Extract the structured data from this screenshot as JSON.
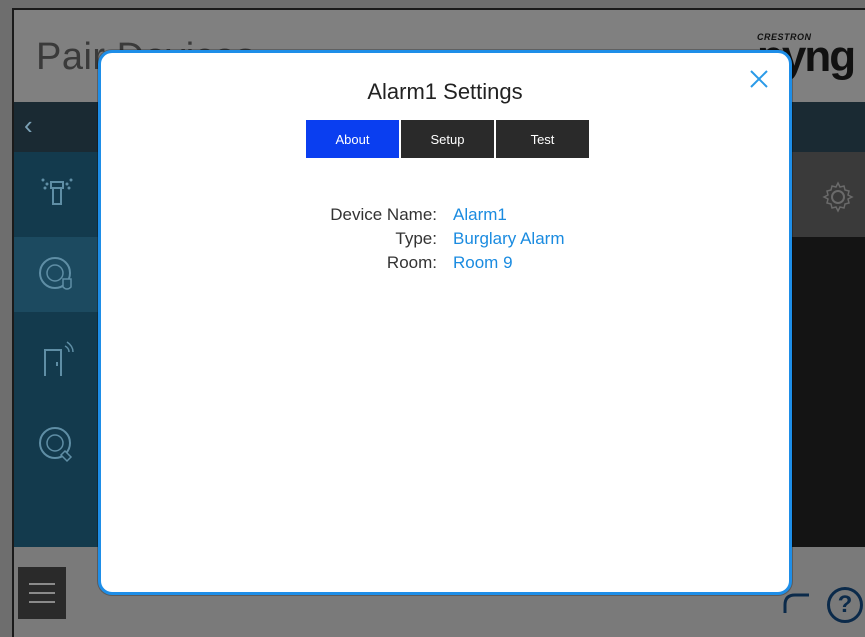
{
  "background": {
    "page_title": "Pair Devices",
    "logo": {
      "small": "CRESTRON",
      "big": "pyng"
    },
    "sidebar": {
      "items": [
        {
          "icon": "sprinkler-icon"
        },
        {
          "icon": "alarm-panel-icon",
          "active": true
        },
        {
          "icon": "door-sensor-icon"
        },
        {
          "icon": "keypad-icon"
        }
      ]
    },
    "help_label": "?"
  },
  "modal": {
    "title": "Alarm1 Settings",
    "tabs": [
      {
        "label": "About",
        "active": true
      },
      {
        "label": "Setup",
        "active": false
      },
      {
        "label": "Test",
        "active": false
      }
    ],
    "fields": [
      {
        "label": "Device Name:",
        "value": "Alarm1"
      },
      {
        "label": "Type:",
        "value": "Burglary Alarm"
      },
      {
        "label": "Room:",
        "value": "Room 9"
      }
    ]
  },
  "colors": {
    "accent": "#1e8ee8",
    "tab_active": "#0a3ef0",
    "tab_inactive": "#2a2a2a",
    "value_text": "#1a8be0"
  }
}
